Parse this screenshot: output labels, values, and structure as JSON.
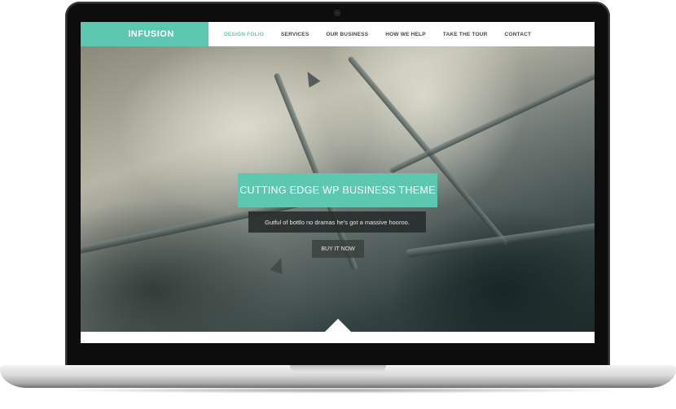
{
  "site": {
    "brand": "INFUSION",
    "nav": [
      {
        "label": "DESIGN FOLIO",
        "active": true
      },
      {
        "label": "SERVICES",
        "active": false
      },
      {
        "label": "OUR BUSINESS",
        "active": false
      },
      {
        "label": "HOW WE HELP",
        "active": false
      },
      {
        "label": "TAKE THE TOUR",
        "active": false
      },
      {
        "label": "CONTACT",
        "active": false
      }
    ],
    "hero": {
      "headline": "CUTTING EDGE WP BUSINESS THEME",
      "subline": "Gutful of bottlo no dramas he's got a massive hooroo.",
      "cta": "BUY IT NOW"
    }
  },
  "colors": {
    "accent": "#5dc8b0",
    "laptop_bezel": "#0d0d0d",
    "laptop_body": "#d9d9d9"
  }
}
